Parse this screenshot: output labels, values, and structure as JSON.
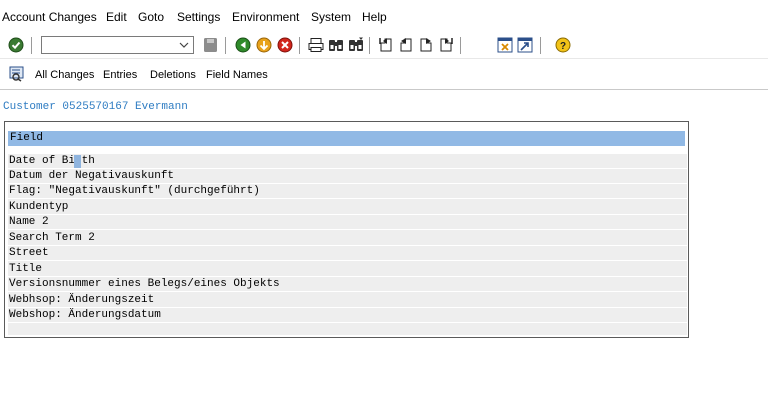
{
  "menubar": {
    "items": [
      "Account Changes",
      "Edit",
      "Goto",
      "Settings",
      "Environment",
      "System",
      "Help"
    ]
  },
  "toolbar": {
    "command_value": "",
    "icons": [
      "enter-icon",
      "save-icon",
      "back-icon",
      "exit-icon",
      "cancel-icon",
      "print-icon",
      "find-icon",
      "find-next-icon",
      "first-page-icon",
      "previous-page-icon",
      "next-page-icon",
      "last-page-icon",
      "new-session-icon",
      "shortcut-icon",
      "help-icon"
    ]
  },
  "app_toolbar": {
    "buttons": [
      "All Changes",
      "Entries",
      "Deletions",
      "Field Names"
    ]
  },
  "title": "Customer 0525570167 Evermann",
  "table": {
    "header": "Field",
    "rows": [
      "Date of Birth",
      "Datum der Negativauskunft",
      "Flag: \"Negativauskunft\" (durchgeführt)",
      "Kundentyp",
      "Name 2",
      "Search Term 2",
      "Street",
      "Title",
      "Versionsnummer eines Belegs/eines Objekts",
      "Webhsop: Änderungszeit",
      "Webshop: Änderungsdatum"
    ]
  },
  "colors": {
    "title_blue": "#2e7cc2",
    "header_bg": "#91b9e5",
    "row_bg": "#eeeeee"
  }
}
